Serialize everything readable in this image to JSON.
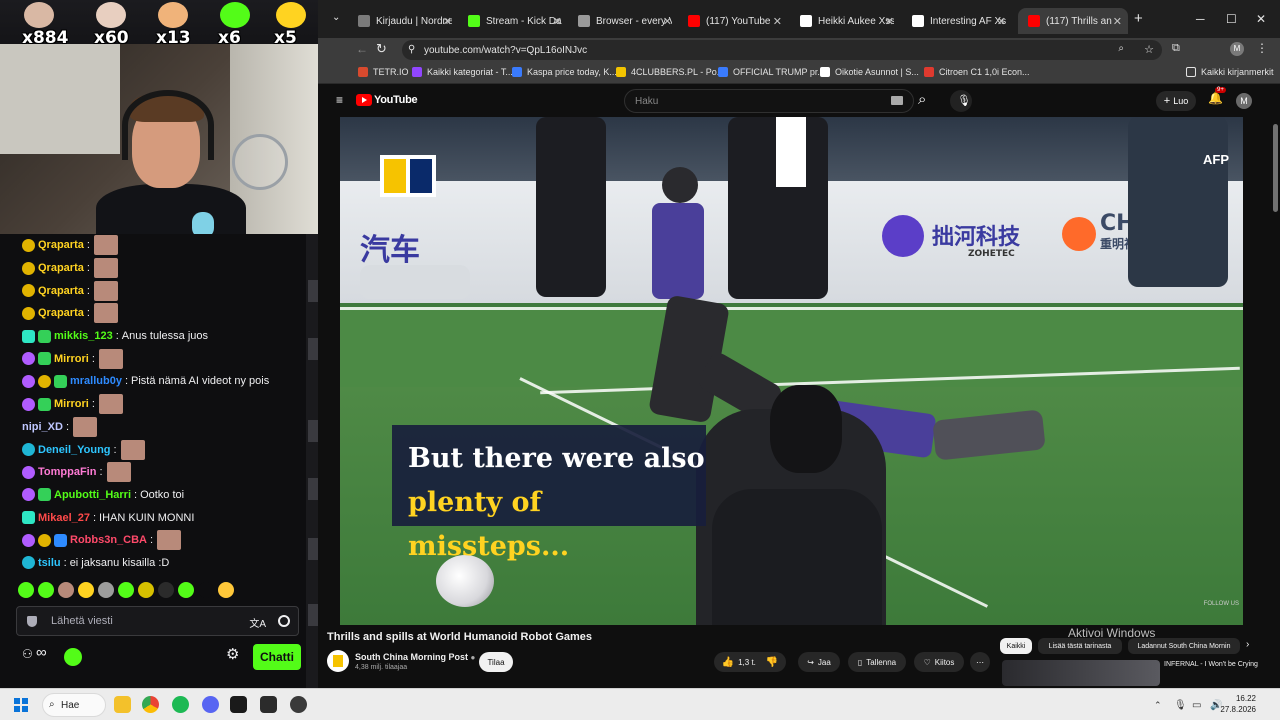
{
  "stream": {
    "emote_counts": [
      "x884",
      "x60",
      "x13",
      "x6",
      "x5"
    ],
    "chat": [
      {
        "user": "Qraparta",
        "color": "#ffd321",
        "badges": [
          "gold"
        ],
        "emote": true,
        "text": ""
      },
      {
        "user": "Qraparta",
        "color": "#ffd321",
        "badges": [
          "gold"
        ],
        "emote": true,
        "text": ""
      },
      {
        "user": "Qraparta",
        "color": "#ffd321",
        "badges": [
          "gold"
        ],
        "emote": true,
        "text": ""
      },
      {
        "user": "Qraparta",
        "color": "#ffd321",
        "badges": [
          "gold"
        ],
        "emote": true,
        "text": ""
      },
      {
        "user": "mikkis_123",
        "color": "#53fc18",
        "badges": [
          "teal",
          "green"
        ],
        "emote": false,
        "text": "Anus tulessa juos"
      },
      {
        "user": "Mirrori",
        "color": "#ffd321",
        "badges": [
          "purple",
          "green"
        ],
        "emote": true,
        "text": ""
      },
      {
        "user": "mrallub0y",
        "color": "#2e8bff",
        "badges": [
          "purple",
          "gold",
          "green"
        ],
        "emote": false,
        "text": "Pistä nämä AI videot ny pois"
      },
      {
        "user": "Mirrori",
        "color": "#ffd321",
        "badges": [
          "purple",
          "green"
        ],
        "emote": true,
        "text": ""
      },
      {
        "user": "nipi_XD",
        "color": "#bfc7ff",
        "badges": [],
        "emote": true,
        "text": ""
      },
      {
        "user": "Deneil_Young",
        "color": "#2ec6ff",
        "badges": [
          "cyan"
        ],
        "emote": true,
        "text": ""
      },
      {
        "user": "TomppaFin",
        "color": "#ff7bd5",
        "badges": [
          "purple"
        ],
        "emote": true,
        "text": ""
      },
      {
        "user": "Apubotti_Harri",
        "color": "#53fc18",
        "badges": [
          "purple",
          "green"
        ],
        "emote": false,
        "text": "Ootko toi"
      },
      {
        "user": "Mikael_27",
        "color": "#ff4a4a",
        "badges": [
          "teal"
        ],
        "emote": false,
        "text": "IHAN KUIN MONNI"
      },
      {
        "user": "Robbs3n_CBA",
        "color": "#ff4a6a",
        "badges": [
          "purple",
          "gold",
          "blue"
        ],
        "emote": true,
        "text": ""
      },
      {
        "user": "tsilu",
        "color": "#2ec6ff",
        "badges": [
          "cyan"
        ],
        "emote": false,
        "text": "ei jaksanu kisailla :D"
      }
    ],
    "input_placeholder": "Lähetä viesti",
    "chat_button": "Chatti"
  },
  "browser": {
    "tabs": [
      {
        "title": "Kirjaudu | Nordnet",
        "color": "#7b7b7b"
      },
      {
        "title": "Stream - Kick Dash",
        "color": "#53fc18"
      },
      {
        "title": "Browser - every Vi",
        "color": "#9a9a9a"
      },
      {
        "title": "(117) YouTube",
        "color": "#ff0000"
      },
      {
        "title": "Heikki Aukee Xss",
        "color": "#ffffff"
      },
      {
        "title": "Interesting AF Xss",
        "color": "#ffffff"
      },
      {
        "title": "(117) Thrills an",
        "color": "#ff0000"
      }
    ],
    "url": "youtube.com/watch?v=QpL16oINJvc",
    "bookmarks": [
      {
        "label": "TETR.IO",
        "color": "#d84a2e"
      },
      {
        "label": "Kaikki kategoriat - T...",
        "color": "#9146ff"
      },
      {
        "label": "Kaspa price today, K...",
        "color": "#3a7bfd"
      },
      {
        "label": "4CLUBBERS.PL - Po...",
        "color": "#f3c400"
      },
      {
        "label": "OFFICIAL TRUMP pr...",
        "color": "#3a7bfd"
      },
      {
        "label": "Oikotie Asunnot | S...",
        "color": "#ffffff"
      },
      {
        "label": "Citroen C1 1,0i Econ...",
        "color": "#e03a2f"
      }
    ],
    "bookmarks_folder": "Kaikki kirjanmerkit"
  },
  "youtube": {
    "logo": "YouTube",
    "search_placeholder": "Haku",
    "create_label": "Luo",
    "notif_count": "9+",
    "avatar_letter": "M",
    "subtitle_line1": "But there were also",
    "subtitle_line2": "plenty of missteps...",
    "afp": "AFP",
    "sponsor1": "汽车",
    "sponsor2": "拙河科技",
    "sponsor3": "CHONIX",
    "sponsor2_sub": "ZOHETEC",
    "sponsor3_sub": "重明视界",
    "follow": "FOLLOW US",
    "video_title": "Thrills and spills at World Humanoid Robot Games",
    "channel_name": "South China Morning Post",
    "channel_subs": "4,38 milj. tilaajaa",
    "subscribe_label": "Tilaa",
    "likes": "1,3 t.",
    "share": "Jaa",
    "save": "Tallenna",
    "thanks": "Kiitos",
    "activate_windows": "Aktivoi Windows",
    "chips": [
      "Kaikki",
      "Lisää tästä tarinasta",
      "Ladannut South China Mornin"
    ],
    "reco_title": "INFERNAL - I Won't be Crying"
  },
  "taskbar": {
    "search_label": "Hae",
    "time": "16.22",
    "date": "27.8.2026"
  }
}
